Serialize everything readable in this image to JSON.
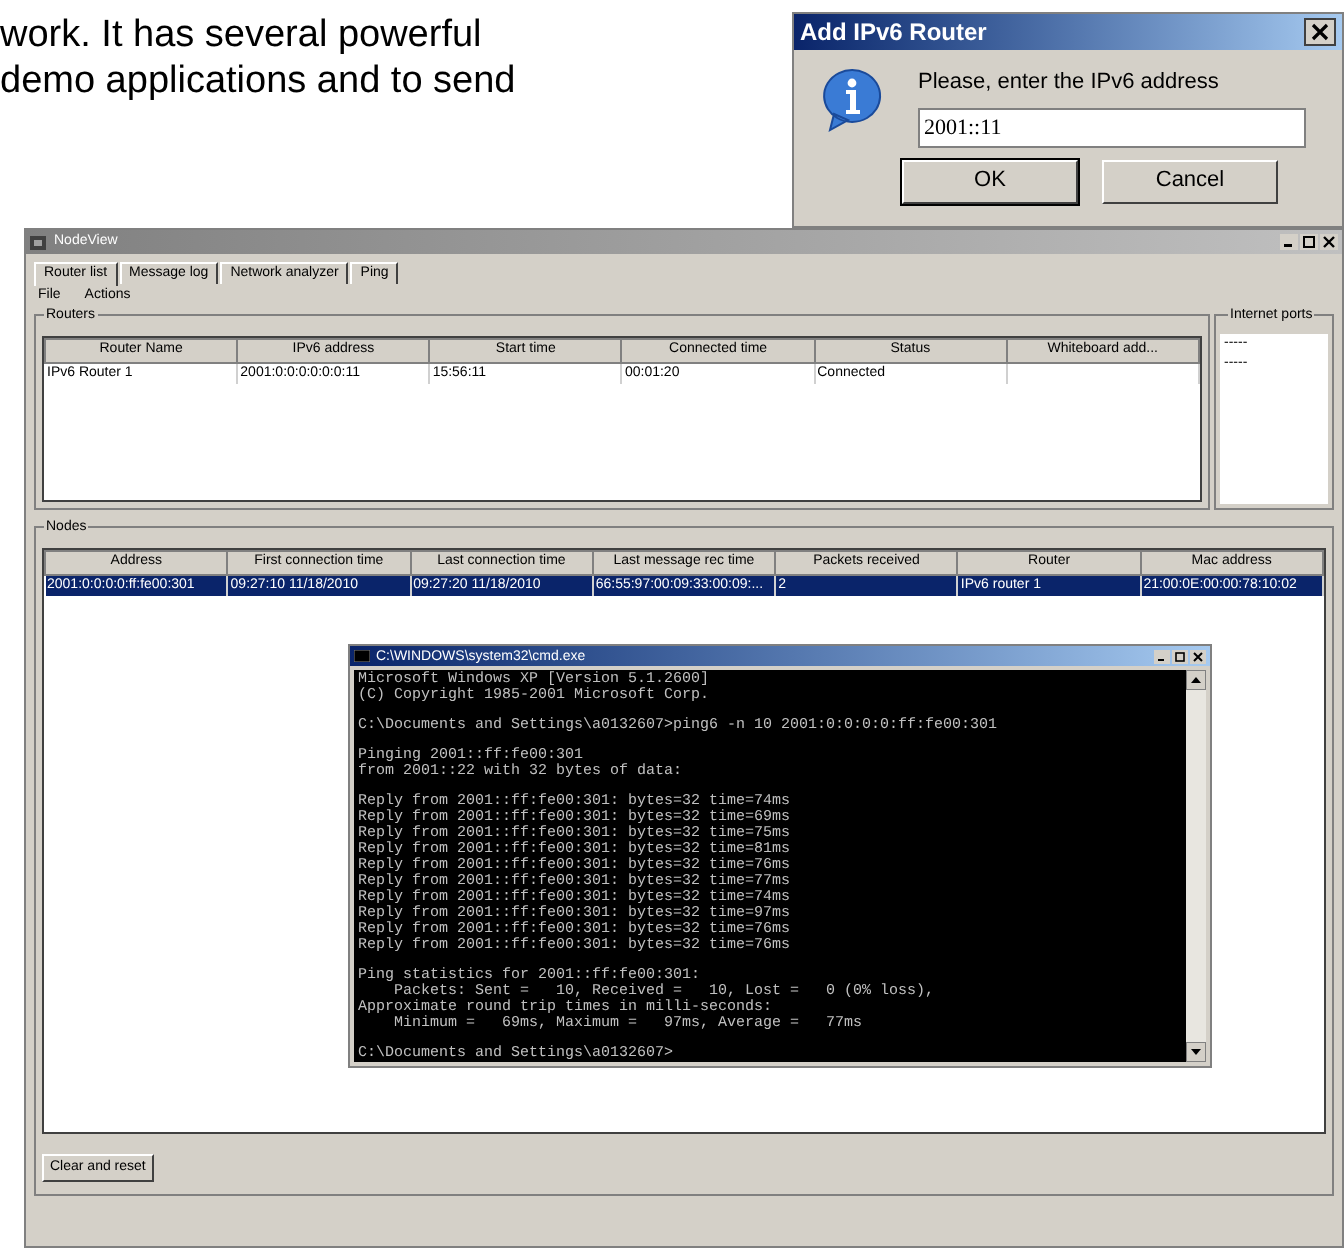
{
  "document": {
    "lines": [
      "work. It has several powerful",
      "demo applications and to send"
    ]
  },
  "dialog": {
    "title": "Add IPv6 Router",
    "prompt": "Please, enter the IPv6 address",
    "value": "2001::11",
    "buttons": [
      "OK",
      "Cancel"
    ]
  },
  "app": {
    "title": "NodeView",
    "tabs": [
      {
        "label": "Router list",
        "selected": true
      },
      {
        "label": "Message log",
        "selected": false
      },
      {
        "label": "Network analyzer",
        "selected": false
      },
      {
        "label": "Ping",
        "selected": false
      }
    ],
    "menu": [
      "File",
      "Actions"
    ],
    "routers": {
      "title": "Routers",
      "columns": [
        "Router Name",
        "IPv6 address",
        "Start time",
        "Connected time",
        "Status",
        "Whiteboard add..."
      ],
      "rows": [
        {
          "cells": [
            "IPv6 Router 1",
            "2001:0:0:0:0:0:0:11",
            "15:56:11",
            "00:01:20",
            "Connected",
            ""
          ],
          "selected": false
        }
      ]
    },
    "ports": {
      "title": "Internet ports",
      "items": [
        "-----",
        "-----"
      ]
    },
    "nodes": {
      "title": "Nodes",
      "columns": [
        "Address",
        "First connection time",
        "Last connection time",
        "Last message rec time",
        "Packets received",
        "Router",
        "Mac address"
      ],
      "rows": [
        {
          "cells": [
            "2001:0:0:0:0:ff:fe00:301",
            "09:27:10 11/18/2010",
            "09:27:20 11/18/2010",
            "66:55:97:00:09:33:00:09:...",
            "2",
            "IPv6 router 1",
            "21:00:0E:00:00:78:10:02"
          ],
          "selected": true
        }
      ]
    },
    "clear_button": "Clear and reset"
  },
  "console": {
    "title": "C:\\WINDOWS\\system32\\cmd.exe",
    "blocks": [
      [
        "Microsoft Windows XP [Version 5.1.2600]",
        "(C) Copyright 1985-2001 Microsoft Corp."
      ],
      [
        "C:\\Documents and Settings\\a0132607>ping6 -n 10 2001:0:0:0:0:ff:fe00:301"
      ],
      [
        "Pinging 2001::ff:fe00:301",
        "from 2001::22 with 32 bytes of data:"
      ],
      [
        "Reply from 2001::ff:fe00:301: bytes=32 time=74ms",
        "Reply from 2001::ff:fe00:301: bytes=32 time=69ms",
        "Reply from 2001::ff:fe00:301: bytes=32 time=75ms",
        "Reply from 2001::ff:fe00:301: bytes=32 time=81ms",
        "Reply from 2001::ff:fe00:301: bytes=32 time=76ms",
        "Reply from 2001::ff:fe00:301: bytes=32 time=77ms",
        "Reply from 2001::ff:fe00:301: bytes=32 time=74ms",
        "Reply from 2001::ff:fe00:301: bytes=32 time=97ms",
        "Reply from 2001::ff:fe00:301: bytes=32 time=76ms",
        "Reply from 2001::ff:fe00:301: bytes=32 time=76ms"
      ],
      [
        "Ping statistics for 2001::ff:fe00:301:",
        "    Packets: Sent =   10, Received =   10, Lost =   0 (0% loss),",
        "Approximate round trip times in milli-seconds:",
        "    Minimum =   69ms, Maximum =   97ms, Average =   77ms"
      ],
      [
        "C:\\Documents and Settings\\a0132607>"
      ]
    ]
  }
}
